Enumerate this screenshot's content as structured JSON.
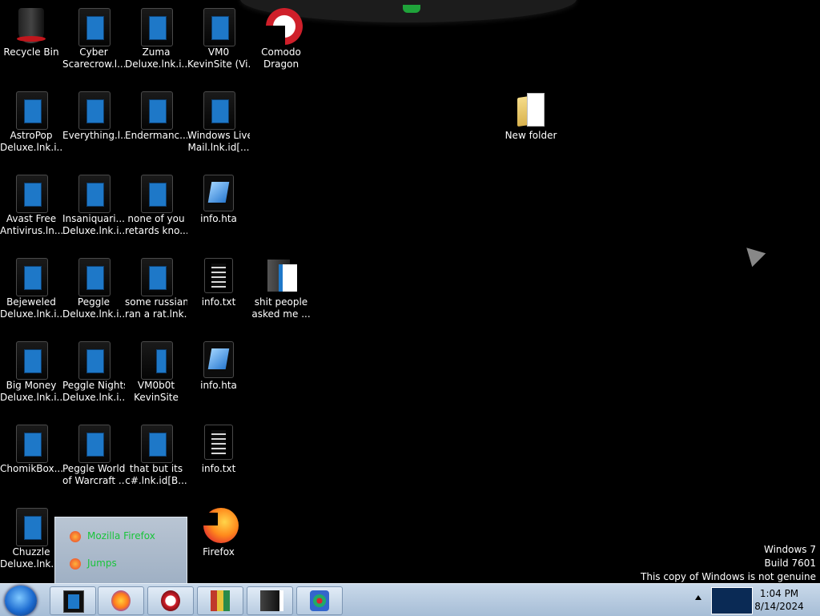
{
  "desktop_icons": [
    {
      "label": "Recycle Bin",
      "kind": "recycle"
    },
    {
      "label": "Cyber Scarecrow.l...",
      "kind": "lnk"
    },
    {
      "label": "Zuma Deluxe.lnk.i...",
      "kind": "lnk"
    },
    {
      "label": "VM0 KevinSite (Vi...",
      "kind": "lnk"
    },
    {
      "label": "Comodo Dragon",
      "kind": "comodo"
    },
    {
      "label": "AstroPop Deluxe.lnk.i...",
      "kind": "lnk"
    },
    {
      "label": "Everything.l...",
      "kind": "lnk"
    },
    {
      "label": "Endermanc...",
      "kind": "lnk"
    },
    {
      "label": "Windows Live Mail.lnk.id[...",
      "kind": "lnk"
    },
    {
      "label": "New folder",
      "kind": "folder"
    },
    {
      "label": "Avast Free Antivirus.ln...",
      "kind": "lnk"
    },
    {
      "label": "Insaniquari... Deluxe.lnk.i...",
      "kind": "lnk"
    },
    {
      "label": "none of you retards kno...",
      "kind": "lnk"
    },
    {
      "label": "info.hta",
      "kind": "hta"
    },
    {
      "label": "Bejeweled Deluxe.lnk.i...",
      "kind": "lnk"
    },
    {
      "label": "Peggle Deluxe.lnk.i...",
      "kind": "lnk"
    },
    {
      "label": "some russian ran a rat.lnk...",
      "kind": "lnk"
    },
    {
      "label": "info.txt",
      "kind": "txt"
    },
    {
      "label": "shit people asked me ...",
      "kind": "darkfolder"
    },
    {
      "label": "Big Money Deluxe.lnk.i...",
      "kind": "lnk"
    },
    {
      "label": "Peggle Nights Deluxe.lnk.i...",
      "kind": "lnk"
    },
    {
      "label": "VM0b0t KevinSite",
      "kind": "lnk-cut"
    },
    {
      "label": "info.hta",
      "kind": "hta"
    },
    {
      "label": "ChomikBox....",
      "kind": "lnk"
    },
    {
      "label": "Peggle World of Warcraft ...",
      "kind": "lnk"
    },
    {
      "label": "that but its c#.lnk.id[B...",
      "kind": "lnk"
    },
    {
      "label": "info.txt",
      "kind": "txt"
    },
    {
      "label": "Chuzzle Deluxe.lnk.i...",
      "kind": "lnk"
    },
    {
      "label": "Firefox",
      "kind": "firefox"
    }
  ],
  "popup": {
    "items": [
      "Mozilla Firefox",
      "Jumps"
    ]
  },
  "watermark": {
    "line1": "Windows 7",
    "line2": "Build 7601",
    "line3": "This copy of Windows is not genuine"
  },
  "taskbar": {
    "buttons": [
      "lnk-app",
      "firefox",
      "comodo-dragon",
      "winrar",
      "folder",
      "office"
    ],
    "time": "1:04 PM",
    "date": "8/14/2024"
  },
  "colors": {
    "popup_text": "#19c43a",
    "taskbar": "#b7cbe0",
    "desktop": "#000000"
  }
}
